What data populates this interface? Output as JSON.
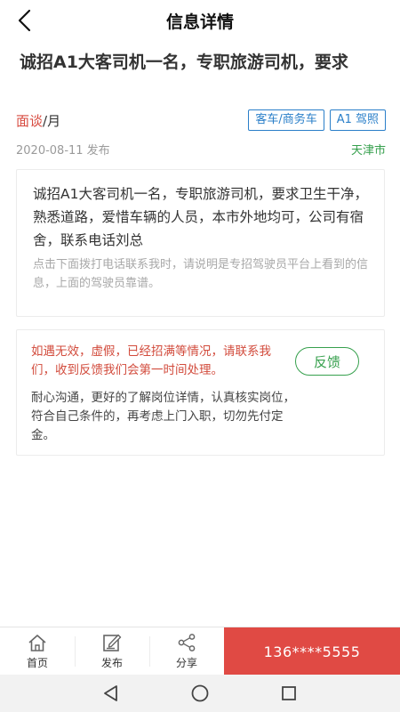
{
  "header": {
    "title": "信息详情",
    "back_icon": "back-arrow-icon"
  },
  "job": {
    "title": "诚招A1大客司机一名，专职旅游司机，要求",
    "salary_highlight": "面谈",
    "salary_unit": "/月",
    "tags": [
      "客车/商务车",
      "A1 驾照"
    ],
    "date": "2020-08-11 发布",
    "city": "天津市"
  },
  "description": {
    "main": "诚招A1大客司机一名，专职旅游司机，要求卫生干净，熟悉道路，爱惜车辆的人员，本市外地均可，公司有宿舍，联系电话刘总",
    "note": "点击下面拨打电话联系我时，请说明是专招驾驶员平台上看到的信息，上面的驾驶员靠谱。"
  },
  "notice": {
    "warning": "如遇无效，虚假，已经招满等情况，请联系我们，收到反馈我们会第一时间处理。",
    "feedback_label": "反馈",
    "tip": "耐心沟通，更好的了解岗位详情，认真核实岗位，符合自己条件的，再考虑上门入职，切勿先付定金。"
  },
  "bottom_nav": {
    "items": [
      {
        "label": "首页",
        "icon": "home-icon"
      },
      {
        "label": "发布",
        "icon": "edit-icon"
      },
      {
        "label": "分享",
        "icon": "share-icon"
      }
    ],
    "call_label": "136****5555"
  },
  "colors": {
    "accent_red": "#e04a44",
    "salary_red": "#d74a3f",
    "tag_blue": "#2a7fc9",
    "green": "#36a04d"
  }
}
